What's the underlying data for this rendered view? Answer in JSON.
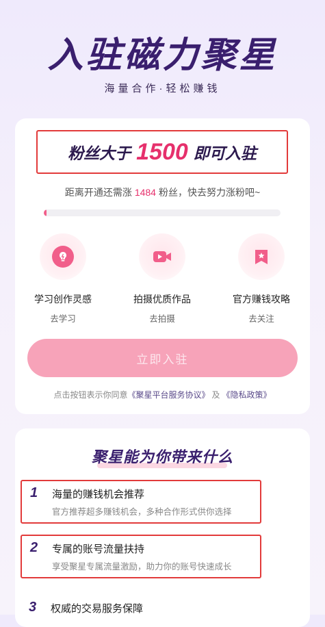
{
  "hero": {
    "title": "入驻磁力聚星",
    "subtitle": "海量合作·轻松赚钱"
  },
  "threshold": {
    "prefix": "粉丝大于",
    "number": "1500",
    "suffix": "即可入驻"
  },
  "distance": {
    "prefix": "距离开通还需涨",
    "count": "1484",
    "suffix": "粉丝，快去努力涨粉吧~"
  },
  "progress": {
    "current": 16,
    "target": 1500
  },
  "features": [
    {
      "icon": "lightbulb-icon",
      "label": "学习创作灵感",
      "link": "去学习"
    },
    {
      "icon": "video-camera-icon",
      "label": "拍摄优质作品",
      "link": "去拍摄"
    },
    {
      "icon": "bookmark-star-icon",
      "label": "官方赚钱攻略",
      "link": "去关注"
    }
  ],
  "join_button": "立即入驻",
  "agreement": {
    "prefix": "点击按钮表示你同意",
    "link1": "《聚星平台服务协议》",
    "middle": "及",
    "link2": "《隐私政策》"
  },
  "benefits": {
    "title": "聚星能为你带来什么",
    "items": [
      {
        "num": "1",
        "title": "海量的赚钱机会推荐",
        "desc": "官方推荐超多赚钱机会，多种合作形式供你选择"
      },
      {
        "num": "2",
        "title": "专属的账号流量扶持",
        "desc": "享受聚星专属流量激励，助力你的账号快速成长"
      },
      {
        "num": "3",
        "title": "权威的交易服务保障",
        "desc": ""
      }
    ]
  },
  "colors": {
    "accent": "#e6306c",
    "brand_dark": "#3a1f6e",
    "button": "#f7a3b9",
    "highlight_box": "#e23a3a"
  }
}
